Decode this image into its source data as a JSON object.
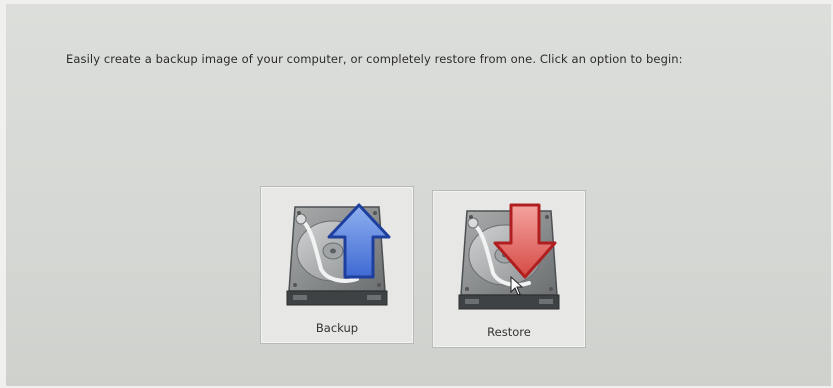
{
  "instruction": "Easily create a backup image of your computer, or completely restore from one.  Click an option to begin:",
  "options": [
    {
      "label": "Backup",
      "icon": "hard-drive-with-up-arrow-icon",
      "arrow_color": "#3a66c6"
    },
    {
      "label": "Restore",
      "icon": "hard-drive-with-down-arrow-icon",
      "arrow_color": "#cc3b3b"
    }
  ],
  "colors": {
    "background": "#d8dad7",
    "panel": "#e7e8e5"
  }
}
